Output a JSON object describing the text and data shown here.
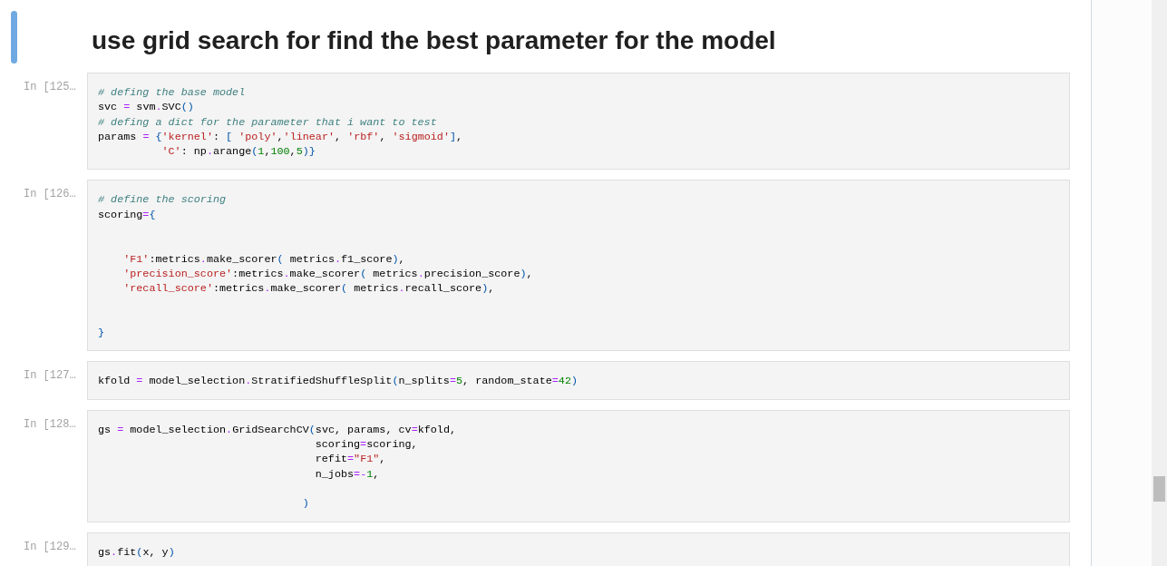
{
  "cells": [
    {
      "kind": "markdown",
      "selected": true,
      "heading": "use grid search for find the best parameter for the model"
    },
    {
      "kind": "code",
      "selected": false,
      "prompt": "In [125…",
      "source": "# defing the base model\nsvc = svm.SVC()\n# defing a dict for the parameter that i want to test\nparams = {'kernel': [ 'poly','linear', 'rbf', 'sigmoid'],\n          'C': np.arange(1,100,5)}"
    },
    {
      "kind": "code",
      "selected": false,
      "prompt": "In [126…",
      "source": "# define the scoring\nscoring={\n\n\n    'F1':metrics.make_scorer( metrics.f1_score),\n    'precision_score':metrics.make_scorer( metrics.precision_score),\n    'recall_score':metrics.make_scorer( metrics.recall_score),\n\n\n}"
    },
    {
      "kind": "code",
      "selected": false,
      "prompt": "In [127…",
      "source": "kfold = model_selection.StratifiedShuffleSplit(n_splits=5, random_state=42)"
    },
    {
      "kind": "code",
      "selected": false,
      "prompt": "In [128…",
      "source": "gs = model_selection.GridSearchCV(svc, params, cv=kfold,\n                                  scoring=scoring,\n                                  refit=\"F1\",\n                                  n_jobs=-1,\n\n                                )"
    },
    {
      "kind": "code",
      "selected": false,
      "prompt": "In [129…",
      "source": "gs.fit(x, y)"
    }
  ]
}
